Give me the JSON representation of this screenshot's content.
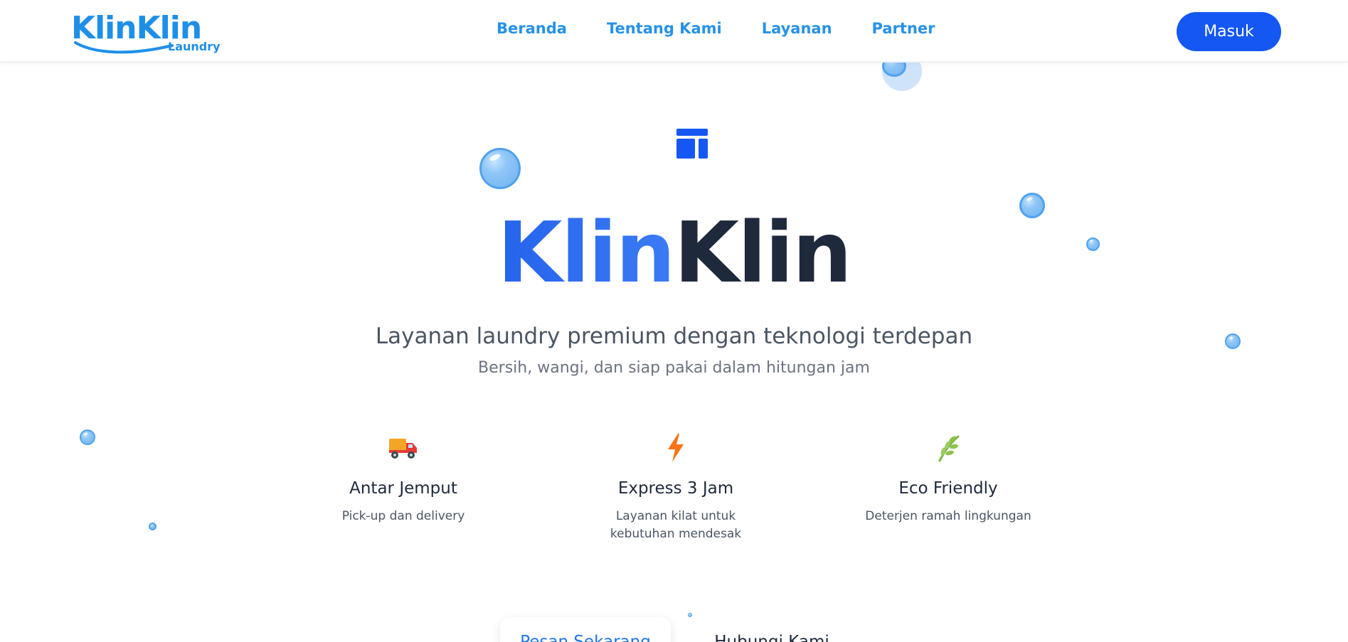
{
  "brand": {
    "logo_text": "KlinKlin",
    "logo_subtext": "Laundry",
    "color": "#1e8fe8"
  },
  "nav": {
    "items": [
      {
        "label": "Beranda"
      },
      {
        "label": "Tentang Kami"
      },
      {
        "label": "Layanan"
      },
      {
        "label": "Partner"
      }
    ],
    "color": "#2692e6"
  },
  "header": {
    "login_label": "Masuk",
    "login_color": "#1557f2"
  },
  "hero": {
    "icon": "layout-icon",
    "title_part1": "Klin",
    "title_part2": "Klin",
    "tagline": "Layanan laundry premium dengan teknologi terdepan",
    "subtagline": "Bersih, wangi, dan siap pakai dalam hitungan jam"
  },
  "features": [
    {
      "icon": "delivery-truck-icon",
      "title": "Antar Jemput",
      "desc": "Pick-up dan delivery"
    },
    {
      "icon": "lightning-icon",
      "title": "Express 3 Jam",
      "desc": "Layanan kilat untuk kebutuhan mendesak"
    },
    {
      "icon": "leaf-icon",
      "title": "Eco Friendly",
      "desc": "Deterjen ramah lingkungan"
    }
  ],
  "cta": {
    "primary_label": "Pesan Sekarang",
    "secondary_label": "Hubungi Kami"
  }
}
